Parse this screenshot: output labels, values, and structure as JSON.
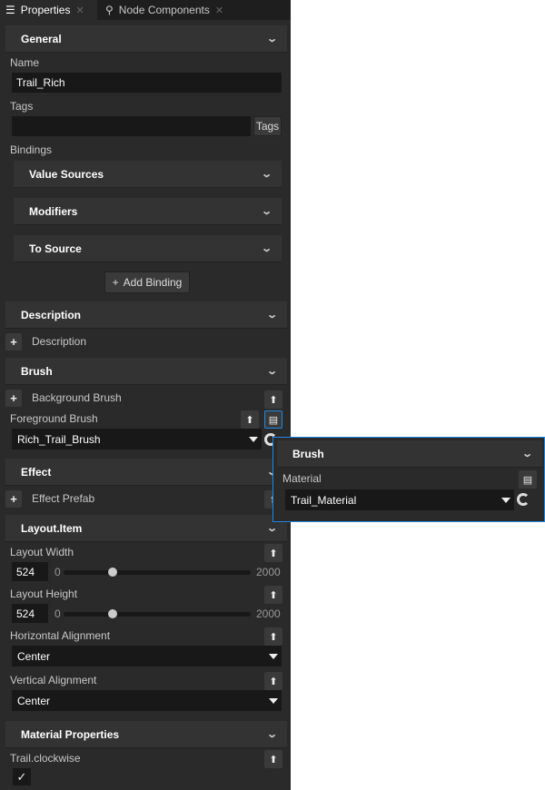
{
  "tabs": [
    {
      "label": "Properties",
      "icon": "list-icon",
      "active": true
    },
    {
      "label": "Node Components",
      "icon": "components-icon",
      "active": false
    }
  ],
  "general": {
    "title": "General",
    "name_label": "Name",
    "name_value": "Trail_Rich",
    "tags_label": "Tags",
    "tags_value": "",
    "tags_button": "Tags",
    "bindings_label": "Bindings",
    "binding_sections": [
      "Value Sources",
      "Modifiers",
      "To Source"
    ],
    "add_binding": "Add Binding"
  },
  "description": {
    "title": "Description",
    "add_label": "Description"
  },
  "brush": {
    "title": "Brush",
    "background_label": "Background Brush",
    "foreground_label": "Foreground Brush",
    "foreground_value": "Rich_Trail_Brush"
  },
  "effect": {
    "title": "Effect",
    "prefab_label": "Effect Prefab"
  },
  "layout": {
    "title": "Layout.Item",
    "width_label": "Layout Width",
    "width_value": "524",
    "height_label": "Layout Height",
    "height_value": "524",
    "slider_min": "0",
    "slider_max": "2000",
    "width_fraction": 0.262,
    "height_fraction": 0.262,
    "halign_label": "Horizontal Alignment",
    "halign_value": "Center",
    "valign_label": "Vertical Alignment",
    "valign_value": "Center"
  },
  "material_props": {
    "title": "Material Properties",
    "clockwise_label": "Trail.clockwise",
    "clockwise_checked": true
  },
  "popup": {
    "title": "Brush",
    "material_label": "Material",
    "material_value": "Trail_Material"
  },
  "colors": {
    "accent": "#1e88e5",
    "panel": "#2a2a2a",
    "header": "#333333",
    "input": "#181818"
  }
}
